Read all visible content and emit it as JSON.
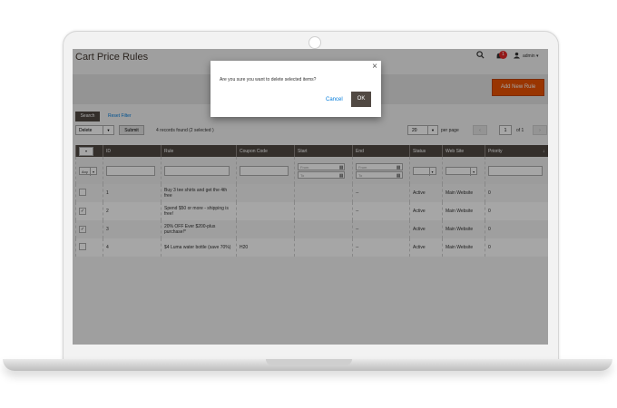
{
  "header": {
    "title": "Cart Price Rules",
    "notification_count": "1",
    "admin_name": "admin",
    "icons": [
      "search-icon",
      "bell-icon",
      "user-icon"
    ]
  },
  "page_actions": {
    "add_button": "Add New Rule"
  },
  "search": {
    "tab_label": "Search",
    "reset_link": "Reset Filter"
  },
  "toolbar": {
    "mass_action": "Delete",
    "submit": "Submit",
    "records_found": "4 records found (2 selected )",
    "per_page_value": "20",
    "per_page_label": "per page",
    "current_page": "1",
    "of_pages": "of 1"
  },
  "grid": {
    "columns": {
      "massaction": "",
      "id": "ID",
      "rule": "Rule",
      "coupon": "Coupon Code",
      "start": "Start",
      "end": "End",
      "status": "Status",
      "website": "Web Site",
      "priority": "Priority"
    },
    "filter": {
      "any": "Any",
      "from": "From",
      "to": "To"
    },
    "rows": [
      {
        "checked": false,
        "id": "1",
        "rule": "Buy 3 tee shirts and get the 4th free",
        "coupon": "",
        "start": "",
        "end": "--",
        "status": "Active",
        "website": "Main Website",
        "priority": "0"
      },
      {
        "checked": true,
        "id": "2",
        "rule": "Spend $50 or more - shipping is free!",
        "coupon": "",
        "start": "",
        "end": "--",
        "status": "Active",
        "website": "Main Website",
        "priority": "0"
      },
      {
        "checked": true,
        "id": "3",
        "rule": "20% OFF Ever $200-plus purchase!*",
        "coupon": "",
        "start": "",
        "end": "--",
        "status": "Active",
        "website": "Main Website",
        "priority": "0"
      },
      {
        "checked": false,
        "id": "4",
        "rule": "$4 Luma water bottle (save 70%)",
        "coupon": "H20",
        "start": "",
        "end": "--",
        "status": "Active",
        "website": "Main Website",
        "priority": "0"
      }
    ]
  },
  "modal": {
    "message": "Are you sure you want to delete selected items?",
    "cancel": "Cancel",
    "ok": "OK"
  },
  "colors": {
    "accent": "#eb5202",
    "header_dark": "#514943",
    "link": "#007bdb",
    "overlay": "rgba(0,0,0,0.35)"
  }
}
